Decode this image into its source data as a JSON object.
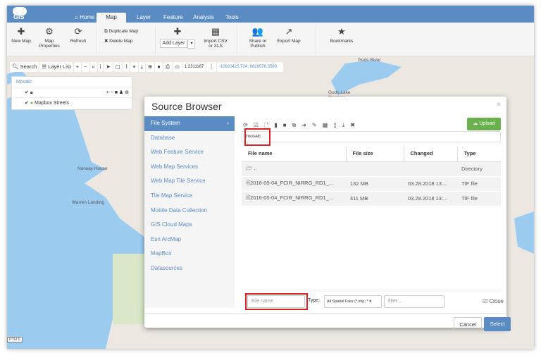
{
  "app": {
    "logo": "GIS"
  },
  "tabs": [
    {
      "label": "Home",
      "icon": "home-icon"
    },
    {
      "label": "Map"
    },
    {
      "label": "Layer"
    },
    {
      "label": "Feature"
    },
    {
      "label": "Analysis"
    },
    {
      "label": "Tools"
    }
  ],
  "ribbon": {
    "new_map": "New Map",
    "map_properties": "Map Properties",
    "refresh": "Refresh",
    "duplicate_map": "Duplicate Map",
    "delete_map": "Delete Map",
    "add_layer": "Add Layer",
    "import_csv": "Import CSV or XLS",
    "share": "Share or Publish",
    "export_map": "Export Map",
    "bookmarks": "Bookmarks"
  },
  "map_toolbar": {
    "search": "Search",
    "layer_list": "Layer List",
    "scale": "1:2311167",
    "coords": "-10820425.724, 6828578.3589"
  },
  "layers": {
    "title": "Mosaic",
    "items": [
      {
        "label": "Mapbox Streets"
      }
    ]
  },
  "map_labels": {
    "gods_river": "Gods River",
    "gods_lake": "Gods Lake Narrows",
    "norway_house": "Norway House",
    "warren_landing": "Warren Landing",
    "road": "PTH 6"
  },
  "dialog": {
    "title": "Source Browser",
    "close": "×",
    "sidebar": [
      "File System",
      "Database",
      "Web Feature Service",
      "Web Map Services",
      "Web Map Tile Service",
      "Tile Map Service",
      "Mobile Data Collection",
      "GIS Cloud Maps",
      "Esri ArcMap",
      "MapBox",
      "Datasources"
    ],
    "upload": "Upload",
    "path": "/mosaic",
    "columns": [
      "File name",
      "File size",
      "Changed",
      "Type"
    ],
    "rows": [
      {
        "name": "..",
        "size": "",
        "changed": "",
        "type": "Directory"
      },
      {
        "name": "2016-05-04_FCIR_NIRRG_RD1_...",
        "size": "132 MB",
        "changed": "03.28.2018 13:...",
        "type": "TIF file"
      },
      {
        "name": "2016-05-04_FCIR_NIRRG_RD1_...",
        "size": "411 MB",
        "changed": "03.28.2018 13:...",
        "type": "TIF file"
      }
    ],
    "file_name_placeholder": "File name",
    "type_label": "Type:",
    "type_value": "All Spatial Files (*.shp; *",
    "filter_placeholder": "filter...",
    "close_label": "Close",
    "cancel": "Cancel",
    "select": "Select"
  },
  "colors": {
    "header": "#5a8cc3",
    "upload": "#6ab04c",
    "highlight": "#e02020",
    "water": "#9ccbf0"
  }
}
